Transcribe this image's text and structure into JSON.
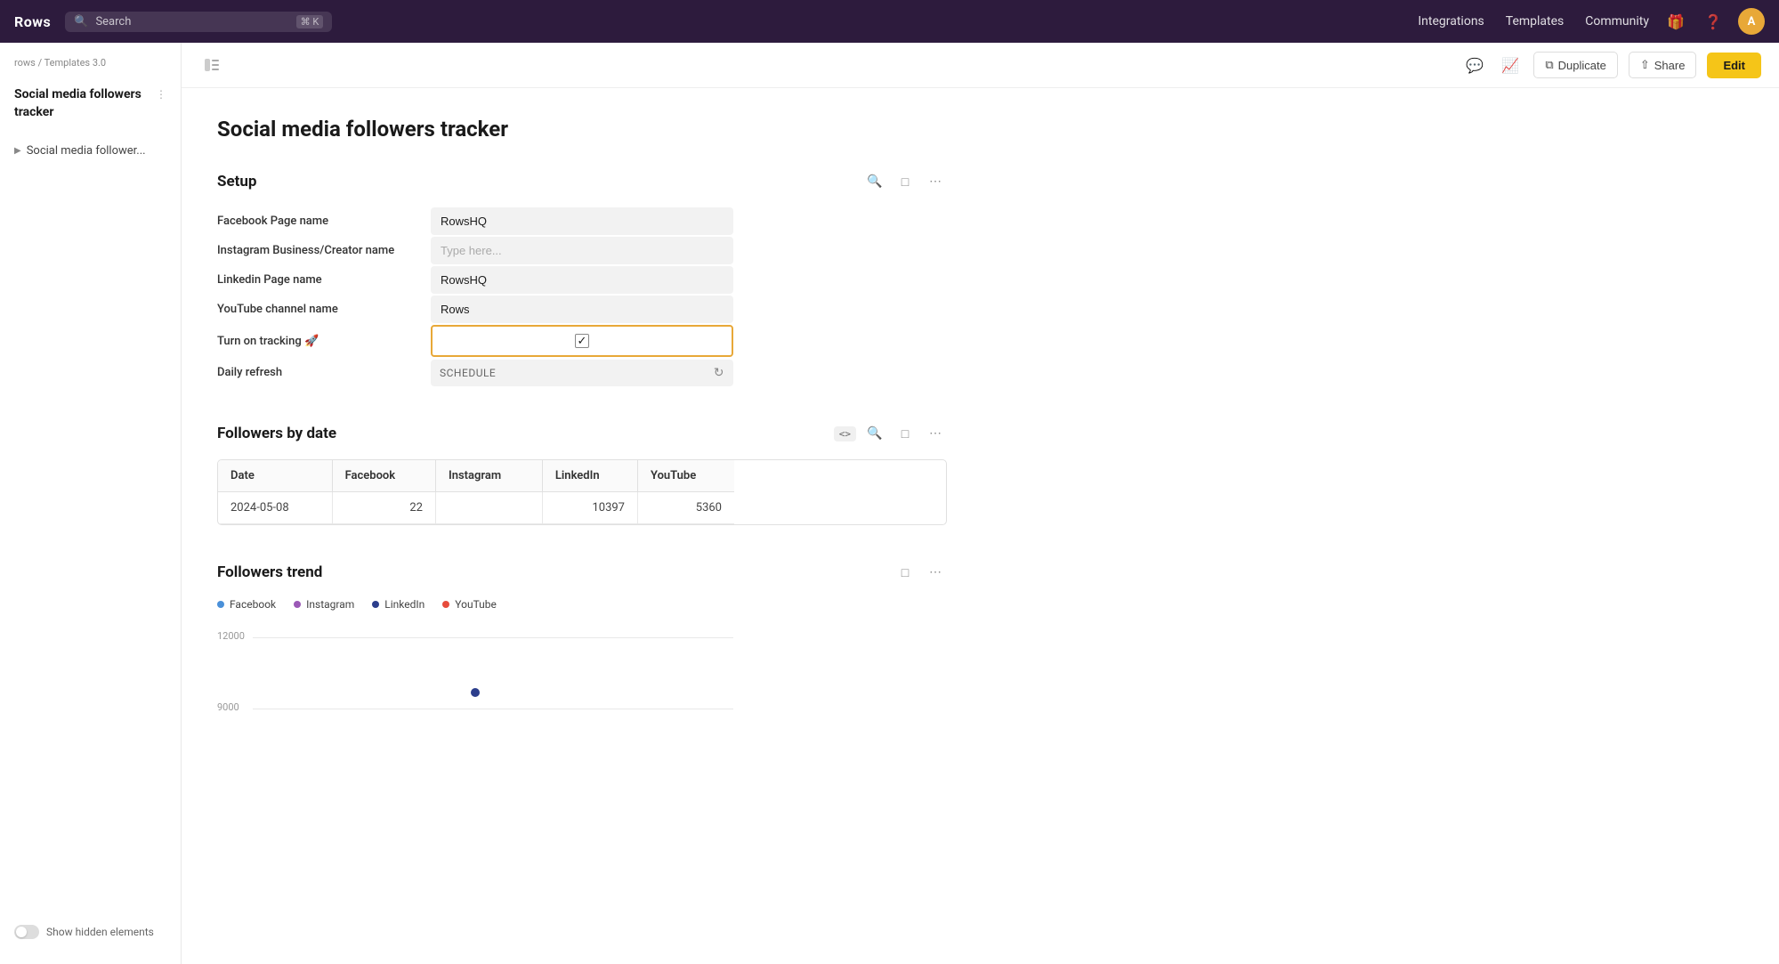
{
  "app": {
    "logo": "Rows",
    "search_placeholder": "Search",
    "search_kbd": "⌘ K"
  },
  "topnav": {
    "integrations_label": "Integrations",
    "templates_label": "Templates",
    "community_label": "Community",
    "gift_icon": "🎁",
    "help_icon": "?",
    "avatar_label": "A"
  },
  "sidebar": {
    "breadcrumb_home": "rows",
    "breadcrumb_sep": "/",
    "breadcrumb_section": "Templates 3.0",
    "doc_title": "Social media followers tracker",
    "item_label": "Social media follower...",
    "show_hidden_label": "Show hidden elements"
  },
  "toolbar": {
    "duplicate_label": "Duplicate",
    "share_label": "Share",
    "edit_label": "Edit"
  },
  "page": {
    "title": "Social media followers tracker"
  },
  "setup": {
    "section_title": "Setup",
    "rows": [
      {
        "label": "Facebook Page name",
        "value": "RowsHQ",
        "placeholder": ""
      },
      {
        "label": "Instagram Business/Creator name",
        "value": "",
        "placeholder": "Type here..."
      },
      {
        "label": "Linkedin Page name",
        "value": "RowsHQ",
        "placeholder": ""
      },
      {
        "label": "YouTube channel name",
        "value": "Rows",
        "placeholder": ""
      }
    ],
    "tracking_label": "Turn on tracking 🚀",
    "tracking_checked": true,
    "daily_refresh_label": "Daily refresh",
    "daily_refresh_value": "SCHEDULE"
  },
  "followers_by_date": {
    "section_title": "Followers by date",
    "columns": [
      "Date",
      "Facebook",
      "Instagram",
      "LinkedIn",
      "YouTube"
    ],
    "rows": [
      {
        "date": "2024-05-08",
        "facebook": "22",
        "instagram": "",
        "linkedin": "10397",
        "youtube": "5360"
      }
    ]
  },
  "followers_trend": {
    "section_title": "Followers trend",
    "legend": [
      {
        "label": "Facebook",
        "color": "#4a90d9"
      },
      {
        "label": "Instagram",
        "color": "#9b59b6"
      },
      {
        "label": "LinkedIn",
        "color": "#2c3e8c"
      },
      {
        "label": "YouTube",
        "color": "#e74c3c"
      }
    ],
    "y_labels": [
      "12000",
      "9000"
    ],
    "data_point": {
      "x": 50,
      "y": 50,
      "color": "#2c3e8c"
    }
  }
}
